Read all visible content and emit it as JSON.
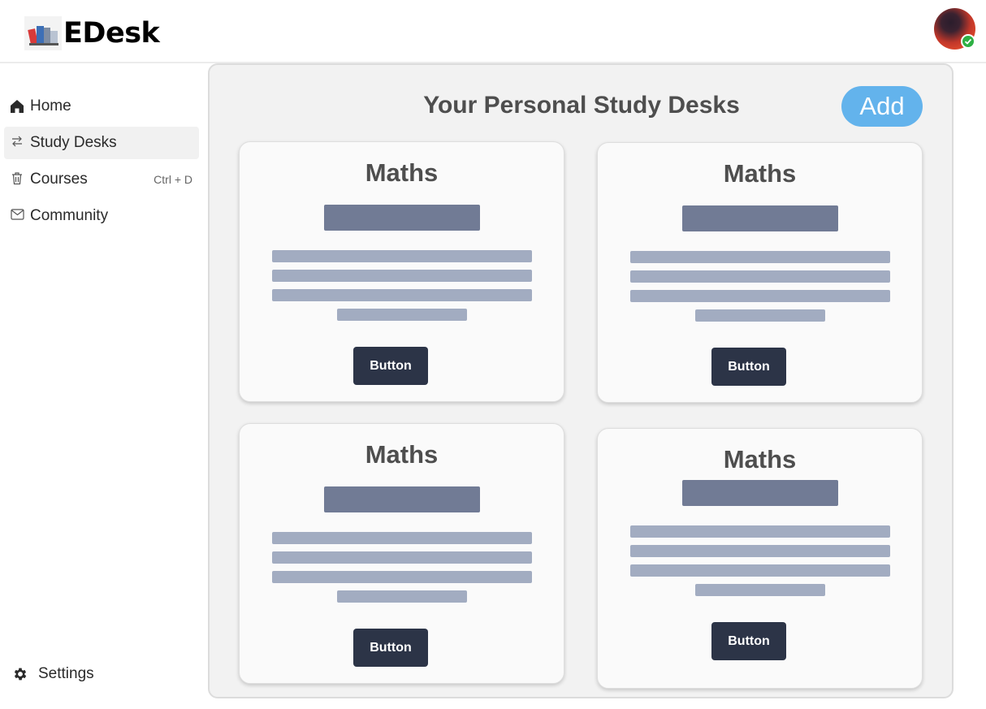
{
  "app": {
    "name": "EDesk"
  },
  "sidebar": {
    "items": [
      {
        "label": "Home",
        "icon": "home-icon"
      },
      {
        "label": "Study Desks",
        "icon": "swap-icon"
      },
      {
        "label": "Courses",
        "icon": "trash-icon",
        "shortcut": "Ctrl + D"
      },
      {
        "label": "Community",
        "icon": "mail-icon"
      }
    ],
    "active_item": "Study Desks",
    "settings_label": "Settings"
  },
  "main": {
    "title": "Your Personal Study Desks",
    "add_label": "Add",
    "cards": [
      {
        "title": "Maths",
        "button_label": "Button"
      },
      {
        "title": "Maths",
        "button_label": "Button"
      },
      {
        "title": "Maths",
        "button_label": "Button"
      },
      {
        "title": "Maths",
        "button_label": "Button"
      }
    ]
  },
  "colors": {
    "accent": "#63b3ec",
    "card_button": "#2c3447",
    "placeholder_dark": "#717b95",
    "placeholder_light": "#a2acc1",
    "status_online": "#2eb044"
  }
}
